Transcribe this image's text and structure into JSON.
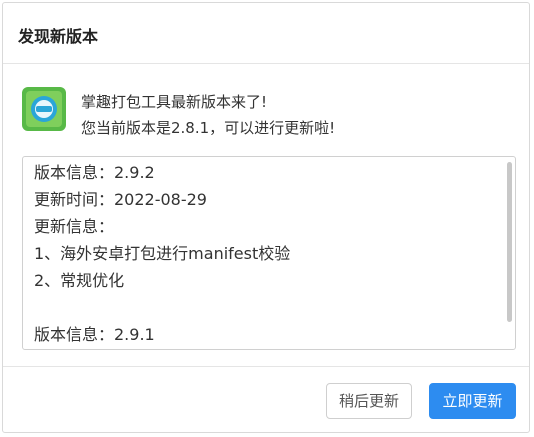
{
  "dialog": {
    "title": "发现新版本"
  },
  "message": {
    "line1": "掌趣打包工具最新版本来了!",
    "line2": "您当前版本是2.8.1，可以进行更新啦!"
  },
  "release_notes": [
    "版本信息：2.9.2",
    "更新时间：2022-08-29",
    "更新信息：",
    "1、海外安卓打包进行manifest校验",
    "2、常规优化",
    "",
    "版本信息：2.9.1"
  ],
  "buttons": {
    "later_label": "稍后更新",
    "update_label": "立即更新"
  },
  "colors": {
    "primary": "#2d8cf0",
    "icon_green": "#58b947",
    "icon_blue": "#2aa6d8"
  },
  "icons": {
    "app": "app-logo-icon"
  }
}
